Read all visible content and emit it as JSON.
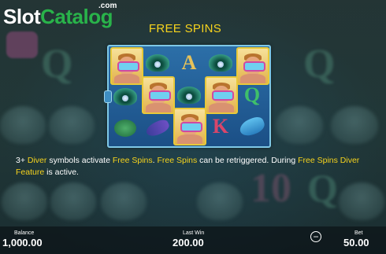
{
  "watermark": {
    "slot": "Slot",
    "catalog": "Catalog",
    "com": ".com"
  },
  "title": "FREE SPINS",
  "reels": {
    "symbols": [
      {
        "type": "diver"
      },
      {
        "type": "clam"
      },
      {
        "type": "A"
      },
      {
        "type": "clam"
      },
      {
        "type": "diver"
      },
      {
        "type": "clam"
      },
      {
        "type": "diver"
      },
      {
        "type": "clam"
      },
      {
        "type": "diver"
      },
      {
        "type": "Q"
      },
      {
        "type": "turtle"
      },
      {
        "type": "fish"
      },
      {
        "type": "diver"
      },
      {
        "type": "K"
      },
      {
        "type": "dolphin"
      }
    ]
  },
  "info": {
    "p1": "3+ ",
    "diver": "Diver",
    "p2": " symbols activate ",
    "fs1": "Free Spins",
    "p3": ". ",
    "fs2": "Free Spins",
    "p4": " can be retriggered. During ",
    "feature_a": "Free Spins Diver",
    "feature_b": "Feature",
    "p5": " is active."
  },
  "bottom": {
    "balance_label": "Balance",
    "balance_value": "1,000.00",
    "lastwin_label": "Last Win",
    "lastwin_value": "200.00",
    "bet_label": "Bet",
    "bet_value": "50.00",
    "minus": "−"
  },
  "colors": {
    "highlight": "#f6d31d",
    "panel": "#2c6fa8",
    "brand_green": "#29b34a"
  }
}
